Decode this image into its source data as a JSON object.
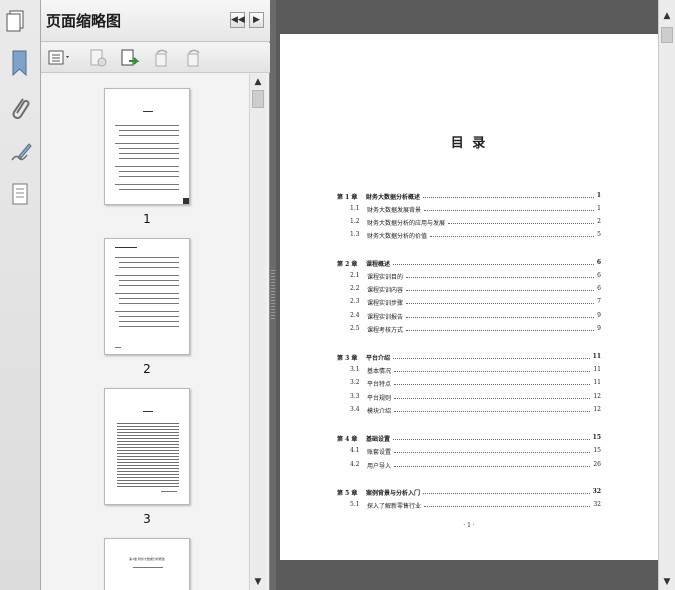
{
  "panel": {
    "title": "页面缩略图",
    "collapse_label": "◀◀",
    "close_label": "▶",
    "thumbnails": [
      {
        "label": "1"
      },
      {
        "label": "2"
      },
      {
        "label": "3"
      }
    ],
    "thumb4_heading": "第1章  财务大数据分析概述"
  },
  "rail": {
    "icons": [
      "bookmark-icon",
      "attachment-icon",
      "signature-icon",
      "layers-icon"
    ]
  },
  "page": {
    "title": "目  录",
    "footer": "· 1 ·",
    "toc": [
      {
        "num": "第 1 章",
        "text": "财务大数据分析概述",
        "page": "1",
        "chapter": true
      },
      {
        "num": "1.1",
        "text": "财务大数据发展背景",
        "page": "1",
        "chapter": false
      },
      {
        "num": "1.2",
        "text": "财务大数据分析的应用与发展",
        "page": "2",
        "chapter": false
      },
      {
        "num": "1.3",
        "text": "财务大数据分析的价值",
        "page": "5",
        "chapter": false
      },
      {
        "num": "第 2 章",
        "text": "课程概述",
        "page": "6",
        "chapter": true
      },
      {
        "num": "2.1",
        "text": "课程实训目的",
        "page": "6",
        "chapter": false
      },
      {
        "num": "2.2",
        "text": "课程实训内容",
        "page": "6",
        "chapter": false
      },
      {
        "num": "2.3",
        "text": "课程实训步骤",
        "page": "7",
        "chapter": false
      },
      {
        "num": "2.4",
        "text": "课程实训报告",
        "page": "9",
        "chapter": false
      },
      {
        "num": "2.5",
        "text": "课程考核方式",
        "page": "9",
        "chapter": false
      },
      {
        "num": "第 3 章",
        "text": "平台介绍",
        "page": "11",
        "chapter": true
      },
      {
        "num": "3.1",
        "text": "基本情况",
        "page": "11",
        "chapter": false
      },
      {
        "num": "3.2",
        "text": "平台特点",
        "page": "11",
        "chapter": false
      },
      {
        "num": "3.3",
        "text": "平台规则",
        "page": "12",
        "chapter": false
      },
      {
        "num": "3.4",
        "text": "模块介绍",
        "page": "12",
        "chapter": false
      },
      {
        "num": "第 4 章",
        "text": "基础设置",
        "page": "15",
        "chapter": true
      },
      {
        "num": "4.1",
        "text": "账套设置",
        "page": "15",
        "chapter": false
      },
      {
        "num": "4.2",
        "text": "用户导入",
        "page": "26",
        "chapter": false
      },
      {
        "num": "第 5 章",
        "text": "案例背景与分析入门",
        "page": "32",
        "chapter": true
      },
      {
        "num": "5.1",
        "text": "探入了解新零售行业",
        "page": "32",
        "chapter": false
      }
    ]
  }
}
